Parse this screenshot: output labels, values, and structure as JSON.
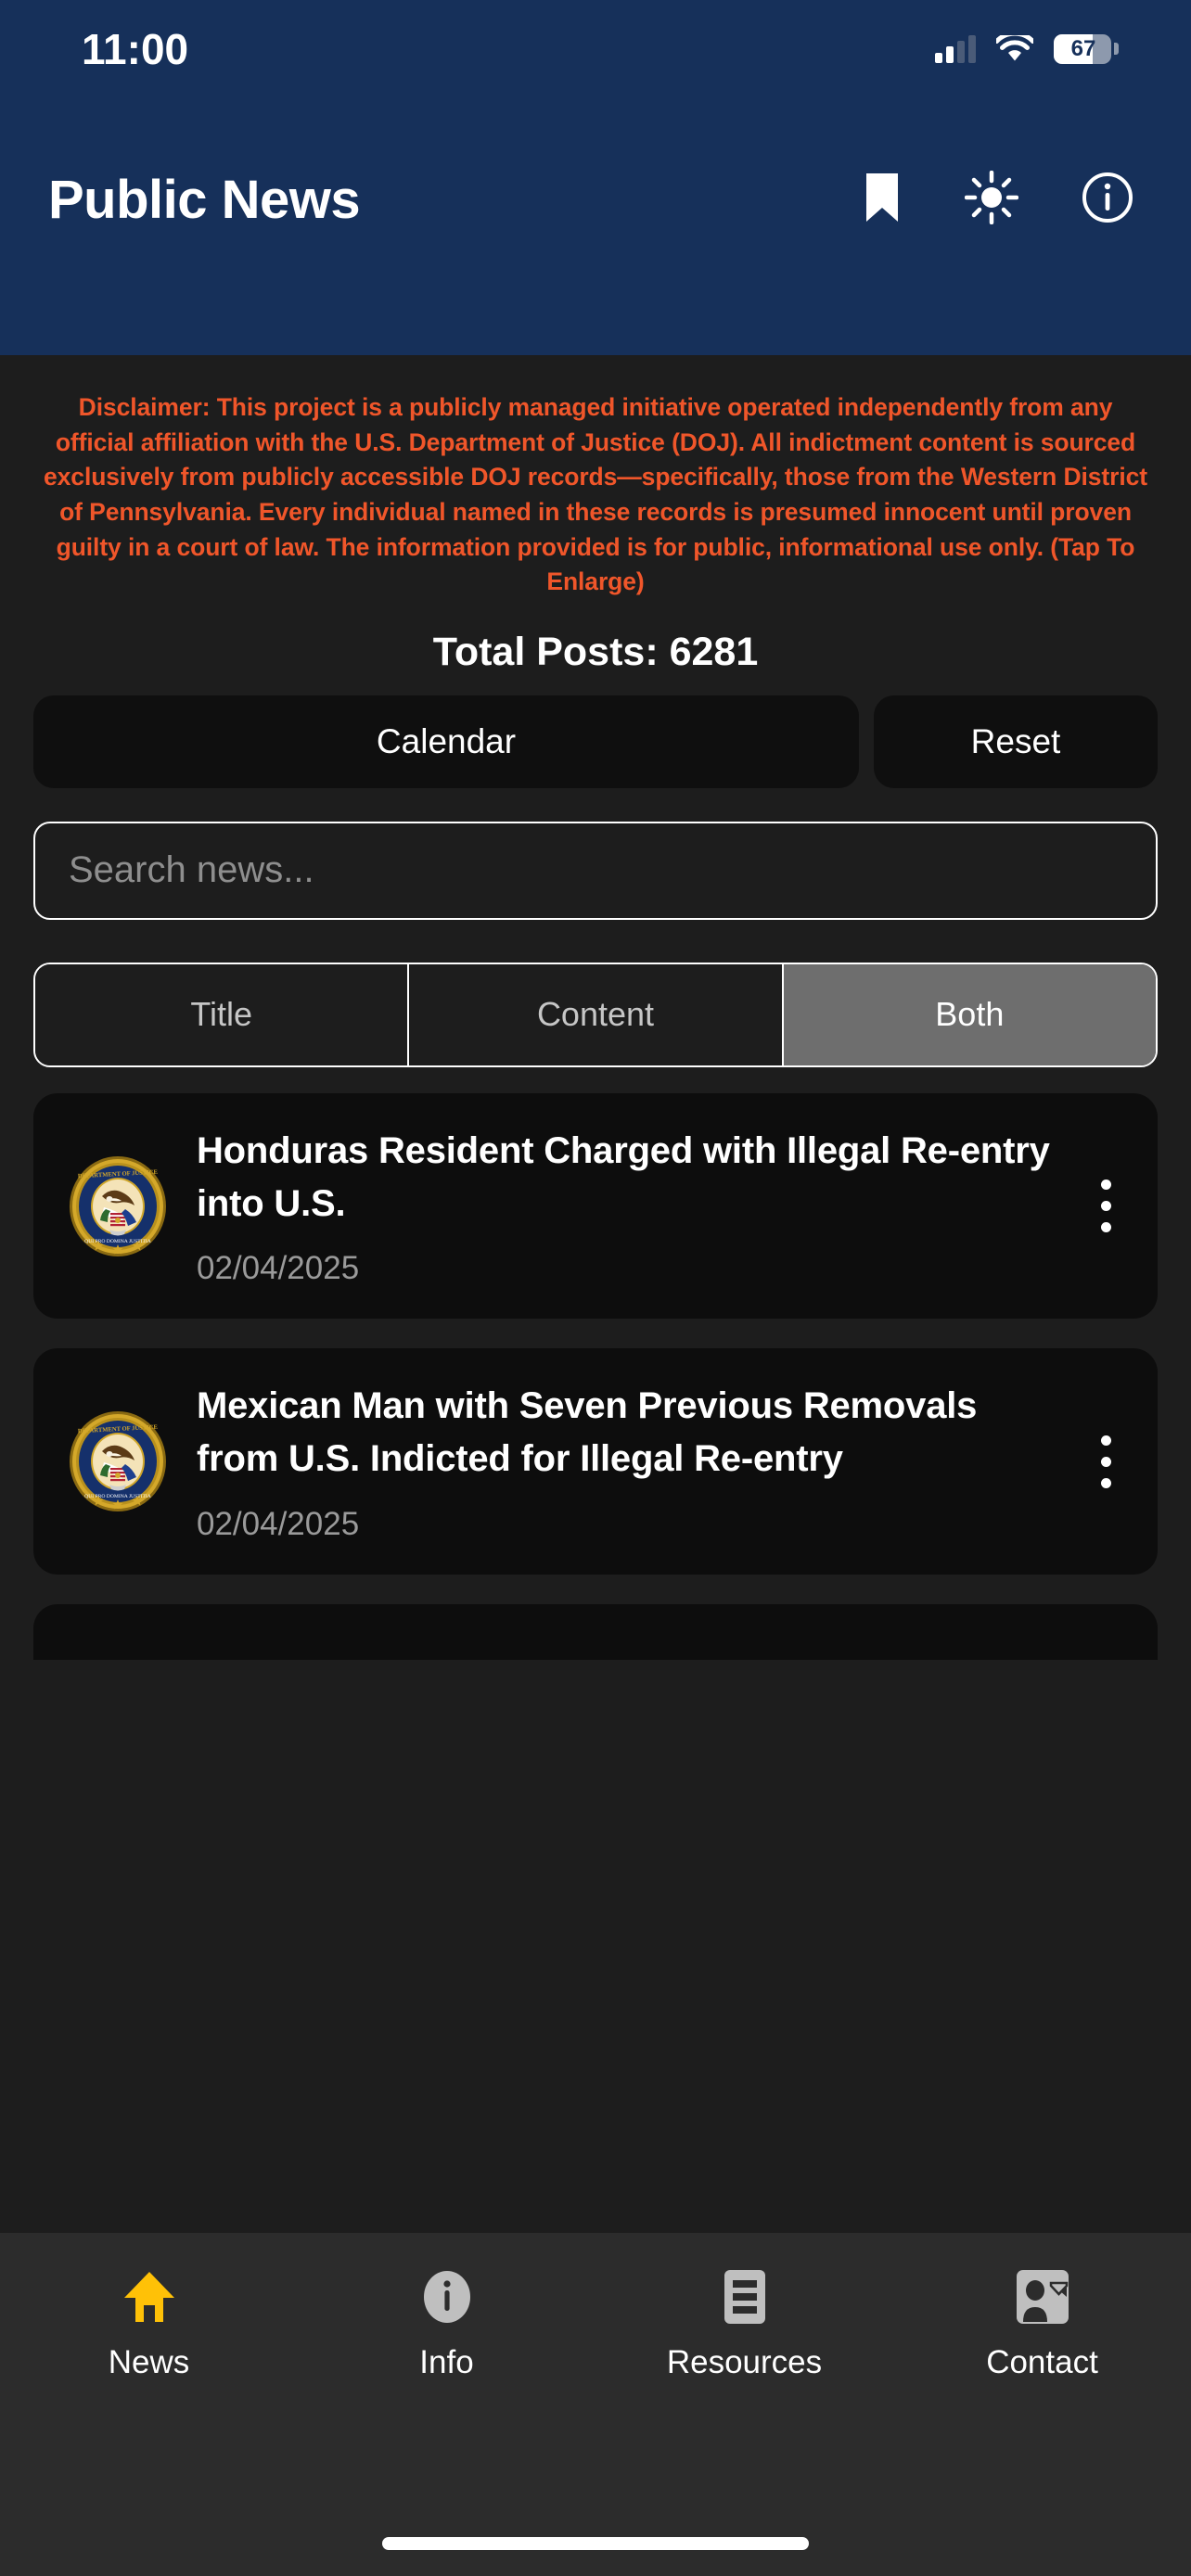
{
  "status_bar": {
    "time": "11:00",
    "battery_percent": "67",
    "battery_level": 67,
    "signal_icon": "cellular-signal-icon",
    "wifi_icon": "wifi-icon",
    "battery_icon": "battery-icon"
  },
  "header": {
    "title": "Public News",
    "background_color": "#16305A",
    "actions": [
      {
        "name": "bookmark-icon",
        "label": "Bookmark"
      },
      {
        "name": "brightness-icon",
        "label": "Brightness"
      },
      {
        "name": "info-circle-icon",
        "label": "Info"
      }
    ]
  },
  "disclaimer": {
    "text": "Disclaimer: This project is a publicly managed initiative operated independently from any official affiliation with the U.S. Department of Justice (DOJ). All indictment content is sourced exclusively from publicly accessible DOJ records—specifically, those from the Western District of Pennsylvania. Every individual named in these records is presumed innocent until proven guilty in a court of law. The information provided is for public, informational use only. (Tap To Enlarge)",
    "color": "#F0562A"
  },
  "stats": {
    "total_posts_label": "Total Posts: 6281",
    "total_posts_count": 6281
  },
  "toolbar": {
    "calendar_label": "Calendar",
    "reset_label": "Reset"
  },
  "search": {
    "placeholder": "Search news...",
    "value": ""
  },
  "filter": {
    "options": [
      {
        "label": "Title",
        "selected": false
      },
      {
        "label": "Content",
        "selected": false
      },
      {
        "label": "Both",
        "selected": true
      }
    ],
    "selected": "Both",
    "active_background": "#6E6E6E"
  },
  "news": {
    "items": [
      {
        "title": "Honduras Resident Charged with Illegal Re-entry into U.S.",
        "date": "02/04/2025",
        "thumbnail": "doj-seal-icon",
        "menu_icon": "kebab-menu-icon"
      },
      {
        "title": "Mexican Man with Seven Previous Removals from U.S. Indicted for Illegal Re-entry",
        "date": "02/04/2025",
        "thumbnail": "doj-seal-icon",
        "menu_icon": "kebab-menu-icon"
      }
    ]
  },
  "tabbar": {
    "items": [
      {
        "label": "News",
        "icon": "home-icon",
        "active": true,
        "color": "#FFC107"
      },
      {
        "label": "Info",
        "icon": "info-circle-icon",
        "active": false,
        "color": "#BFBFBF"
      },
      {
        "label": "Resources",
        "icon": "list-document-icon",
        "active": false,
        "color": "#BFBFBF"
      },
      {
        "label": "Contact",
        "icon": "contact-card-icon",
        "active": false,
        "color": "#BFBFBF"
      }
    ]
  }
}
